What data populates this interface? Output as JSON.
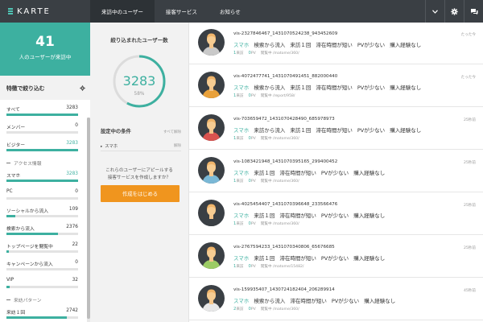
{
  "app": {
    "logo_text": "KARTE",
    "nav_tabs": [
      "来訪中のユーザー",
      "接客サービス",
      "お知らせ"
    ],
    "icons": [
      "chevron-down-icon",
      "gear-icon",
      "chat-icon"
    ]
  },
  "sidebar": {
    "user_count": "41",
    "user_count_label": "人のユーザーが来訪中",
    "filter_title": "特徴で絞り込む",
    "filters": [
      {
        "label": "すべて",
        "value": "3283",
        "fill": 1.0,
        "highlight": false
      },
      {
        "label": "メンバー",
        "value": "0",
        "fill": 0.0,
        "highlight": false
      },
      {
        "label": "ビジター",
        "value": "3283",
        "fill": 1.0,
        "highlight": true
      }
    ],
    "section_access": "アクセス情報",
    "access_filters": [
      {
        "label": "スマホ",
        "value": "3283",
        "fill": 1.0,
        "highlight": true
      },
      {
        "label": "PC",
        "value": "0",
        "fill": 0.0,
        "highlight": false
      },
      {
        "label": "ソーシャルから流入",
        "value": "109",
        "fill": 0.12,
        "highlight": false
      },
      {
        "label": "検索から流入",
        "value": "2376",
        "fill": 0.72,
        "highlight": false
      },
      {
        "label": "トップページを閲覧中",
        "value": "22",
        "fill": 0.03,
        "highlight": false
      },
      {
        "label": "キャンペーンから流入",
        "value": "0",
        "fill": 0.0,
        "highlight": false
      },
      {
        "label": "VIP",
        "value": "32",
        "fill": 0.04,
        "highlight": false
      }
    ],
    "section_visit": "来訪パターン",
    "visit_filters": [
      {
        "label": "来訪１回",
        "value": "2742",
        "fill": 0.84,
        "highlight": false
      }
    ]
  },
  "mid": {
    "title": "絞り込まれたユーザー数",
    "count": "3283",
    "percent": "58%",
    "percent_value": 0.58,
    "conditions_title": "設定中の条件",
    "clear_all": "すべて解除",
    "condition_bullet": "▸",
    "condition": "スマホ",
    "condition_remove": "解除",
    "appeal_line1": "これらのユーザーにアピールする",
    "appeal_line2": "接客サービスを作成しますか？",
    "cta": "作成をはじめる"
  },
  "visitors": [
    {
      "id": "vis-2327846467_1431070524238_943452609",
      "device": "スマホ",
      "tags": [
        "検索から流入",
        "来訪１回",
        "滞在時間が短い",
        "PVが少ない",
        "購入経験なし"
      ],
      "visits": "1",
      "visits_label": "来訪",
      "pv": "0",
      "pv_label": "PV",
      "page_label": "閲覧中",
      "page": "/matome/360/",
      "time": "たった今",
      "shirt": "#c9c9c9"
    },
    {
      "id": "vis-4072477741_1431070491451_882000440",
      "device": "スマホ",
      "tags": [
        "検索から流入",
        "来訪１回",
        "滞在時間が短い",
        "PVが少ない",
        "購入経験なし"
      ],
      "visits": "1",
      "visits_label": "来訪",
      "pv": "0",
      "pv_label": "PV",
      "page_label": "閲覧中",
      "page": "/report/958/",
      "time": "たった今",
      "shirt": "#e9a13a"
    },
    {
      "id": "vis-703659472_1431070428490_685978973",
      "device": "スマホ",
      "tags": [
        "来訪から流入",
        "来訪１回",
        "滞在時間が短い",
        "PVが少ない",
        "購入経験なし"
      ],
      "visits": "1",
      "visits_label": "来訪",
      "pv": "0",
      "pv_label": "PV",
      "page_label": "閲覧中",
      "page": "/matome/360/",
      "time": "25秒前",
      "shirt": "#d9534f"
    },
    {
      "id": "vis-1083421948_1431070395165_299400452",
      "device": "スマホ",
      "tags": [
        "来訪１回",
        "滞在時間が短い",
        "PVが少ない",
        "購入経験なし"
      ],
      "visits": "1",
      "visits_label": "来訪",
      "pv": "0",
      "pv_label": "PV",
      "page_label": "閲覧中",
      "page": "/matome/360/",
      "time": "25秒前",
      "shirt": "#7ab8d6"
    },
    {
      "id": "vis-4025454407_1431070396648_233566476",
      "device": "スマホ",
      "tags": [
        "来訪１回",
        "滞在時間が短い",
        "PVが少ない",
        "購入経験なし"
      ],
      "visits": "1",
      "visits_label": "来訪",
      "pv": "0",
      "pv_label": "PV",
      "page_label": "閲覧中",
      "page": "/matome/360/",
      "time": "25秒前",
      "shirt": "#3a3f44"
    },
    {
      "id": "vis-2767594233_1431070340806_65676685",
      "device": "スマホ",
      "tags": [
        "来訪１回",
        "滞在時間が短い",
        "PVが少ない",
        "購入経験なし"
      ],
      "visits": "1",
      "visits_label": "来訪",
      "pv": "0",
      "pv_label": "PV",
      "page_label": "閲覧中",
      "page": "/matome/15482/",
      "time": "25秒前",
      "shirt": "#9ccc65"
    },
    {
      "id": "vis-159935407_1430724182404_206289914",
      "device": "スマホ",
      "tags": [
        "検索から流入",
        "滞在時間が短い",
        "PVが少ない",
        "購入経験なし"
      ],
      "visits": "2",
      "visits_label": "来訪",
      "pv": "0",
      "pv_label": "PV",
      "page_label": "閲覧中",
      "page": "/matome/360/",
      "time": "45秒前",
      "shirt": "#e8e8e8"
    }
  ],
  "colors": {
    "accent": "#3db0a0",
    "topbar": "#3a3f44",
    "cta": "#f0951e"
  }
}
